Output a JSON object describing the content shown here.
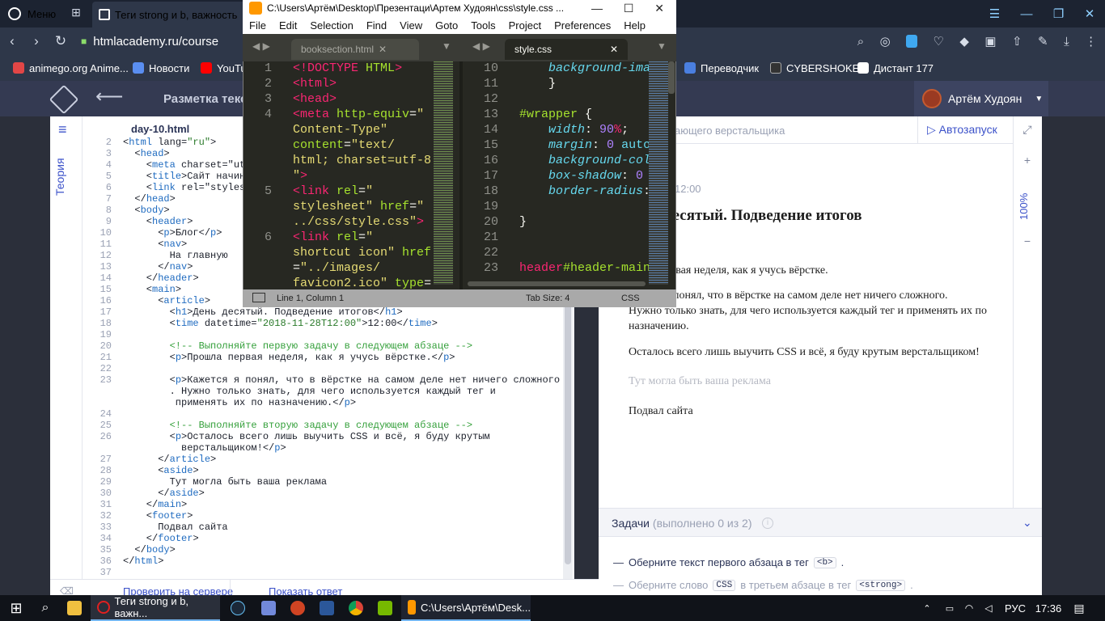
{
  "browser": {
    "menu_label": "Меню",
    "tab_title": "Теги strong и b, важность",
    "url": "htmlacademy.ru/course",
    "bookmarks": [
      "animego.org Anime...",
      "Новости",
      "YouTu",
      "Переводчик",
      "CYBERSHOKE",
      "Дистант 177"
    ]
  },
  "academy": {
    "course_title": "Разметка текс",
    "user_name": "Артём Худоян",
    "rail_label": "Теория",
    "file_tab": "day-10.html",
    "breadcrumb": "ающего верстальщика",
    "autorun_label": "Автозапуск",
    "zoom": "100%",
    "check_button": "Проверить на сервере",
    "show_button": "Показать ответ"
  },
  "code": {
    "gutter": [
      "2",
      "3",
      "4",
      "5",
      "6",
      "7",
      "8",
      "9",
      "10",
      "11",
      "12",
      "13",
      "14",
      "15",
      "16",
      "17",
      "18",
      "19",
      "20",
      "21",
      "22",
      "23",
      "",
      "",
      "24",
      "25",
      "26",
      "",
      "27",
      "28",
      "29",
      "30",
      "31",
      "32",
      "33",
      "34",
      "35",
      "36",
      "37"
    ],
    "lines": [
      "<html lang=\"ru\">",
      "  <head>",
      "    <meta charset=\"utf",
      "    <title>Сайт начин",
      "    <link rel=\"styles",
      "  </head>",
      "  <body>",
      "    <header>",
      "      <p>Блог</p>",
      "      <nav>",
      "        На главную",
      "      </nav>",
      "    </header>",
      "    <main>",
      "      <article>",
      "        <h1>День десятый. Подведение итогов</h1>",
      "        <time datetime=\"2018-11-28T12:00\">12:00</time>",
      "",
      "        <!-- Выполняйте первую задачу в следующем абзаце -->",
      "        <p>Прошла первая неделя, как я учусь вёрстке.</p>",
      "",
      "        <p>Кажется я понял, что в вёрстке на самом деле нет ничего сложного",
      "        . Нужно только знать, для чего используется каждый тег и",
      "         применять их по назначению.</p>",
      "",
      "        <!-- Выполняйте вторую задачу в следующем абзаце -->",
      "        <p>Осталось всего лишь выучить CSS и всё, я буду крутым",
      "          верстальщиком!</p>",
      "      </article>",
      "      <aside>",
      "        Тут могла быть ваша реклама",
      "      </aside>",
      "    </main>",
      "    <footer>",
      "      Подвал сайта",
      "    </footer>",
      "  </body>",
      "</html>",
      ""
    ]
  },
  "preview": {
    "time": "12:00",
    "h1": "десятый. Подведение итогов",
    "p1": "ервая неделя, как я учусь вёрстке.",
    "p2a": "понял, что в вёрстке на самом деле нет ничего сложного.",
    "p2b": "Нужно только знать, для чего используется каждый тег и применять их по",
    "p2c": "назначению.",
    "p3": "Осталось всего лишь выучить CSS и всё, я буду крутым верстальщиком!",
    "aside": "Тут могла быть ваша реклама",
    "footer": "Подвал сайта"
  },
  "tasks": {
    "title": "Задачи",
    "count": "(выполнено 0 из 2)",
    "task1_pre": "Оберните текст первого абзаца в тег",
    "task1_code": "<b>",
    "task2_pre": "Оберните слово",
    "task2_code1": "CSS",
    "task2_mid": "в третьем абзаце в тег",
    "task2_code2": "<strong>"
  },
  "sublime": {
    "title": "C:\\Users\\Артём\\Desktop\\Презентаци\\Артем Худоян\\css\\style.css ...",
    "menu": [
      "File",
      "Edit",
      "Selection",
      "Find",
      "View",
      "Goto",
      "Tools",
      "Project",
      "Preferences",
      "Help"
    ],
    "tab_left": "booksection.html",
    "tab_right": "style.css",
    "status_pos": "Line 1, Column 1",
    "status_tab": "Tab Size: 4",
    "status_syntax": "CSS"
  },
  "taskbar": {
    "opera_item": "Теги strong и b, важн...",
    "sublime_item": "C:\\Users\\Артём\\Desk...",
    "lang": "РУС",
    "time": "17:36"
  },
  "colors": {
    "accent": "#3b51c9",
    "subl_bg": "#272822",
    "taskbar": "#101319"
  }
}
